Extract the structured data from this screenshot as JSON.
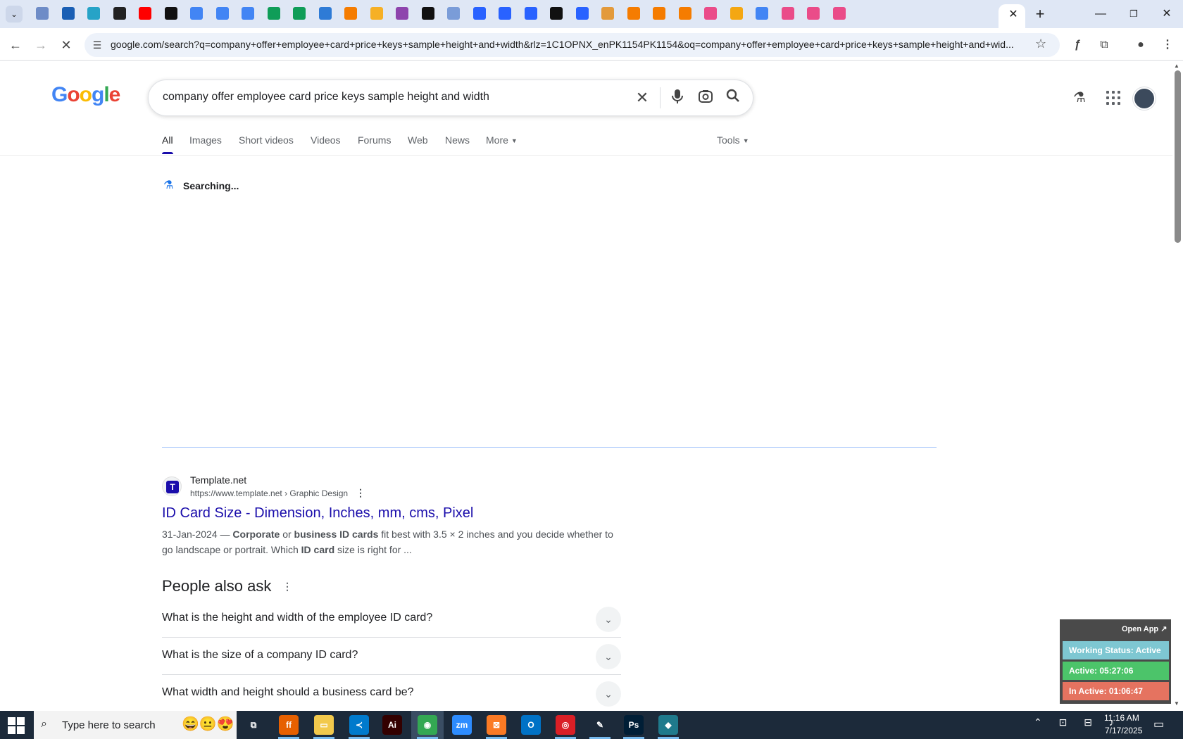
{
  "browser": {
    "tab_icons": [
      {
        "name": "tab-icon-generic-1",
        "color": "#6e8cc7"
      },
      {
        "name": "tab-icon-vector",
        "color": "#1a5fb4"
      },
      {
        "name": "tab-icon-hex",
        "color": "#26a3c7"
      },
      {
        "name": "tab-icon-openai",
        "color": "#222222"
      },
      {
        "name": "tab-icon-youtube",
        "color": "#ff0000"
      },
      {
        "name": "tab-icon-bolt",
        "color": "#111111"
      },
      {
        "name": "tab-icon-docs-1",
        "color": "#4285f4"
      },
      {
        "name": "tab-icon-docs-2",
        "color": "#4285f4"
      },
      {
        "name": "tab-icon-docs-3",
        "color": "#4285f4"
      },
      {
        "name": "tab-icon-sheets-1",
        "color": "#0f9d58"
      },
      {
        "name": "tab-icon-sheets-2",
        "color": "#0f9d58"
      },
      {
        "name": "tab-icon-mj",
        "color": "#2e7bd6"
      },
      {
        "name": "tab-icon-xampp-1",
        "color": "#f57c00"
      },
      {
        "name": "tab-icon-v",
        "color": "#f6b026"
      },
      {
        "name": "tab-icon-brackets",
        "color": "#8e44ad"
      },
      {
        "name": "tab-icon-ai",
        "color": "#111111"
      },
      {
        "name": "tab-icon-grid",
        "color": "#7a9cd8"
      },
      {
        "name": "tab-icon-forms-1",
        "color": "#2962ff"
      },
      {
        "name": "tab-icon-forms-2",
        "color": "#2962ff"
      },
      {
        "name": "tab-icon-forms-3",
        "color": "#2962ff"
      },
      {
        "name": "tab-icon-m",
        "color": "#111111"
      },
      {
        "name": "tab-icon-forms-4",
        "color": "#2962ff"
      },
      {
        "name": "tab-icon-hand",
        "color": "#e39a3b"
      },
      {
        "name": "tab-icon-xampp-2",
        "color": "#f57c00"
      },
      {
        "name": "tab-icon-xampp-3",
        "color": "#f57c00"
      },
      {
        "name": "tab-icon-xampp-4",
        "color": "#f57c00"
      },
      {
        "name": "tab-icon-dribbble-1",
        "color": "#ea4c89"
      },
      {
        "name": "tab-icon-circle",
        "color": "#f4a712"
      },
      {
        "name": "tab-icon-google",
        "color": "#4285f4"
      },
      {
        "name": "tab-icon-dribbble-2",
        "color": "#ea4c89"
      },
      {
        "name": "tab-icon-dribbble-3",
        "color": "#ea4c89"
      },
      {
        "name": "tab-icon-dribbble-4",
        "color": "#ea4c89"
      }
    ],
    "active_tab_close": "✕",
    "new_tab": "+",
    "url": "google.com/search?q=company+offer+employee+card+price+keys+sample+height+and+width&rlz=1C1OPNX_enPK1154PK1154&oq=company+offer+employee+card+price+keys+sample+height+and+wid..."
  },
  "google": {
    "query": "company offer employee card price keys sample height and width",
    "tabs": [
      {
        "label": "All",
        "active": true
      },
      {
        "label": "Images"
      },
      {
        "label": "Short videos"
      },
      {
        "label": "Videos"
      },
      {
        "label": "Forums"
      },
      {
        "label": "Web"
      },
      {
        "label": "News"
      },
      {
        "label": "More"
      }
    ],
    "tools_label": "Tools",
    "searching_text": "Searching...",
    "result": {
      "site_name": "Template.net",
      "url_line": "https://www.template.net › Graphic Design",
      "title": "ID Card Size - Dimension, Inches, mm, cms, Pixel",
      "snippet_date": "31-Jan-2024 —",
      "snippet_b1": "Corporate",
      "snippet_t1": "or",
      "snippet_b2": "business ID cards",
      "snippet_t2": "fit best with 3.5 × 2 inches and you decide whether to go landscape or portrait. Which",
      "snippet_b3": "ID card",
      "snippet_t3": "size is right for ..."
    },
    "people_also_ask": {
      "title": "People also ask",
      "questions": [
        "What is the height and width of the employee ID card?",
        "What is the size of a company ID card?",
        "What width and height should a business card be?"
      ]
    }
  },
  "widget": {
    "open_app": "Open App ↗",
    "working_status": "Working Status: Active",
    "active": "Active: 05:27:06",
    "inactive": "In Active: 01:06:47",
    "colors": {
      "working": "#7ec7d2",
      "active": "#4cc46a",
      "inactive": "#e57360"
    }
  },
  "taskbar": {
    "search_placeholder": "Type here to search",
    "apps": [
      {
        "name": "task-view-app",
        "label": "⧉",
        "color": "transparent"
      },
      {
        "name": "firefox-app",
        "label": "ff",
        "color": "#e66000"
      },
      {
        "name": "file-explorer-app",
        "label": "▭",
        "color": "#f2c94c"
      },
      {
        "name": "vscode-app",
        "label": "≺",
        "color": "#007acc"
      },
      {
        "name": "illustrator-app",
        "label": "Ai",
        "color": "#330000"
      },
      {
        "name": "chrome-app",
        "label": "◉",
        "color": "#34a853"
      },
      {
        "name": "zoom-app",
        "label": "zm",
        "color": "#2d8cff"
      },
      {
        "name": "xampp-app",
        "label": "⊠",
        "color": "#fb7a24"
      },
      {
        "name": "outlook-app",
        "label": "O",
        "color": "#0072c6"
      },
      {
        "name": "creative-cloud-app",
        "label": "◎",
        "color": "#da1f26"
      },
      {
        "name": "pen-app",
        "label": "✎",
        "color": "transparent"
      },
      {
        "name": "photoshop-app",
        "label": "Ps",
        "color": "#001e36"
      },
      {
        "name": "diamond-app",
        "label": "◆",
        "color": "#1f7a8c"
      }
    ],
    "time": "11:16 AM",
    "date": "7/17/2025"
  }
}
